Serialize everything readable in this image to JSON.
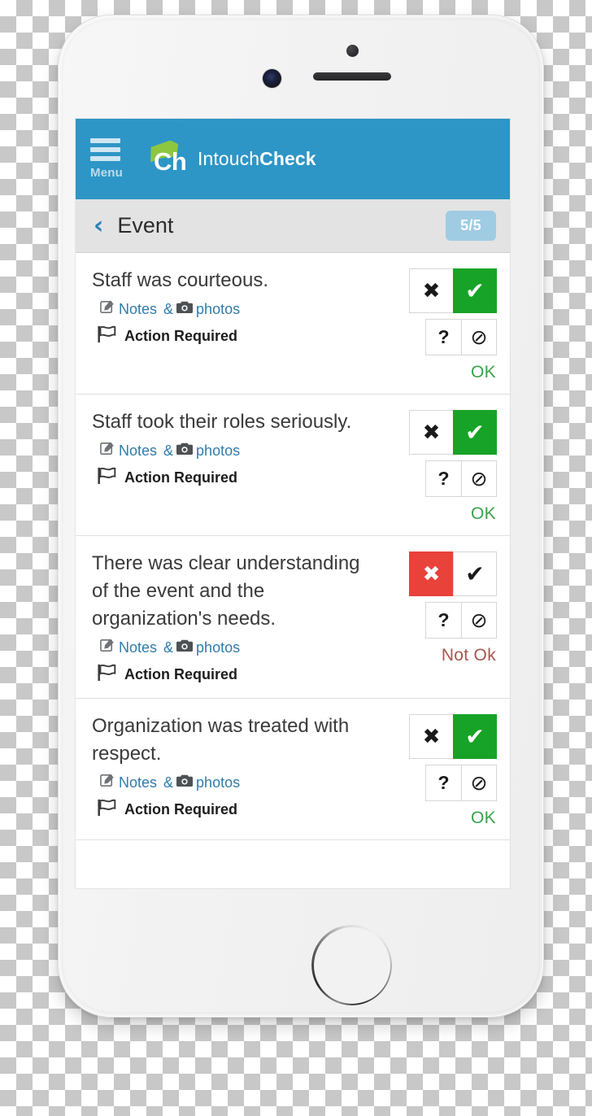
{
  "app_bar": {
    "menu_label": "Menu",
    "menu_icon": "hamburger-menu-icon",
    "logo_mark_text": "Ch",
    "brand_prefix": "Intouch",
    "brand_suffix": "Check",
    "background_color": "#2d96c6",
    "logo_flag_color": "#8dc63f"
  },
  "section_bar": {
    "back_icon": "chevron-left-icon",
    "back_glyph": "‹",
    "title": "Event",
    "progress_badge": "5/5",
    "badge_color": "#9fcbe3"
  },
  "answer_buttons": {
    "no_glyph": "✖",
    "yes_glyph": "✔",
    "unknown_glyph": "?",
    "na_glyph": "⊘",
    "selected_yes_color": "#17a327",
    "selected_no_color": "#e8423a"
  },
  "labels": {
    "notes_prefix": "Notes",
    "notes_amp": "&",
    "notes_suffix": "photos",
    "action_required": "Action Required",
    "edit_icon": "edit-note-icon",
    "camera_icon": "camera-icon",
    "flag_icon": "flag-icon"
  },
  "status_colors": {
    "ok": "#3aa34a",
    "not_ok": "#a8564f"
  },
  "checklist": {
    "items": [
      {
        "question": "Staff was courteous.",
        "answer": "yes",
        "status": "OK"
      },
      {
        "question": "Staff took their roles seriously.",
        "answer": "yes",
        "status": "OK"
      },
      {
        "question": "There was clear understanding of the event and the organization's needs.",
        "answer": "no",
        "status": "Not Ok"
      },
      {
        "question": "Organization was treated with respect.",
        "answer": "yes",
        "status": "OK"
      }
    ]
  },
  "device": {
    "sensor_icon": "proximity-sensor-icon",
    "camera_icon": "front-camera-icon",
    "speaker_icon": "earpiece-speaker-icon",
    "home_icon": "home-button-icon"
  }
}
